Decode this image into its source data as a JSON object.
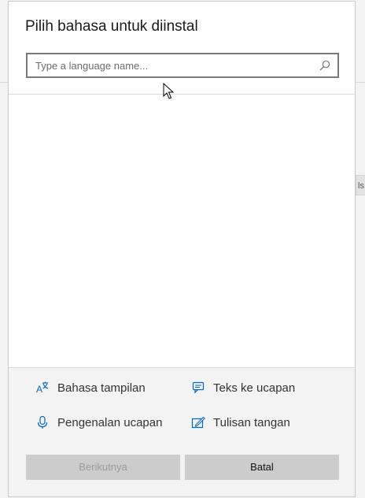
{
  "dialog": {
    "title": "Pilih bahasa untuk diinstal",
    "search": {
      "placeholder": "Type a language name...",
      "value": "",
      "icon": "search-icon"
    },
    "features": [
      {
        "label": "Bahasa tampilan",
        "icon": "display-language-icon"
      },
      {
        "label": "Teks ke ucapan",
        "icon": "text-to-speech-icon"
      },
      {
        "label": "Pengenalan ucapan",
        "icon": "microphone-icon"
      },
      {
        "label": "Tulisan tangan",
        "icon": "handwriting-icon"
      }
    ],
    "buttons": {
      "next_label": "Berikutnya",
      "cancel_label": "Batal"
    }
  },
  "background": {
    "chip_text": "ls"
  },
  "colors": {
    "accent": "#0067c0",
    "button_bg": "#cccccc",
    "disabled_text": "#9a9a9a"
  }
}
